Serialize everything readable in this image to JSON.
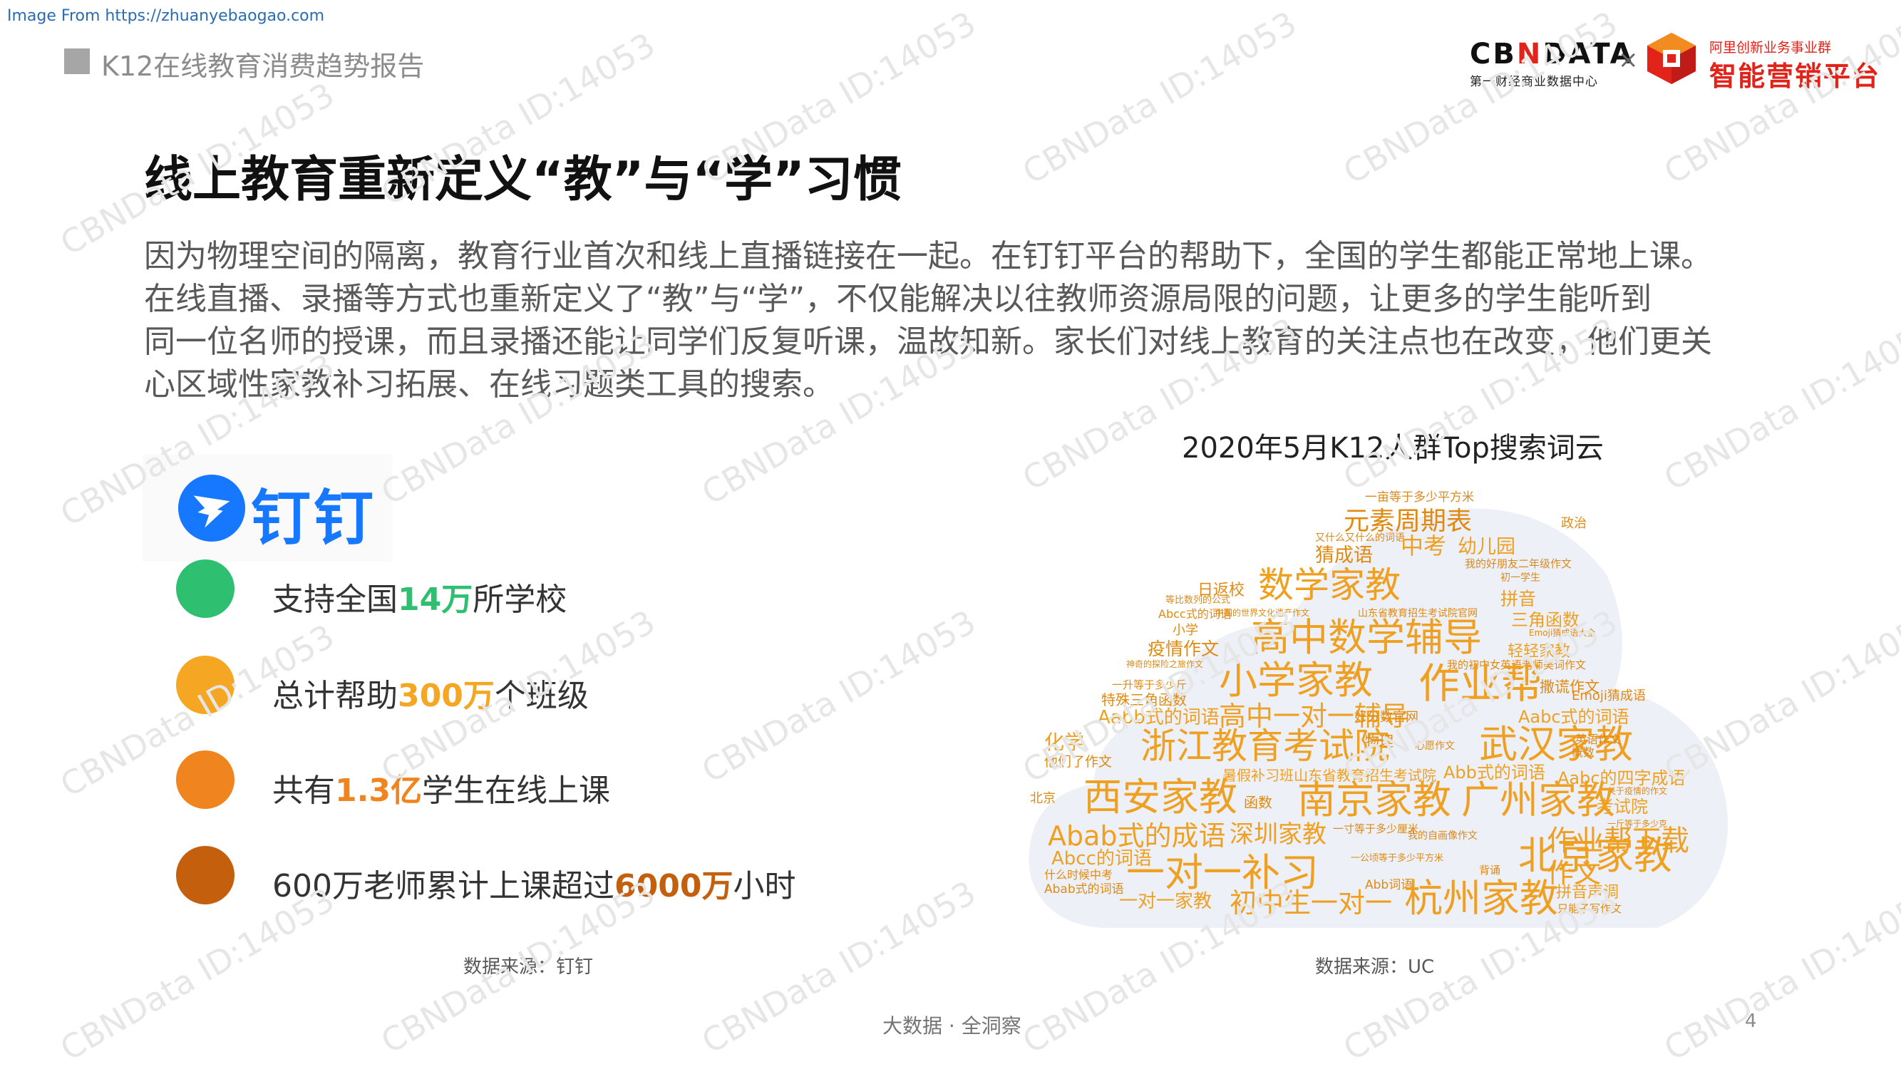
{
  "source_link": "Image From https://zhuanyebaogao.com",
  "report_title": "K12在线教育消费趋势报告",
  "heading": "线上教育重新定义“教”与“学”习惯",
  "intro_lines": [
    "因为物理空间的隔离，教育行业首次和线上直播链接在一起。在钉钉平台的帮助下，全国的学生都能正常地上课。",
    "在线直播、录播等方式也重新定义了“教”与“学”，不仅能解决以往教师资源局限的问题，让更多的学生能听到",
    "同一位名师的授课，而且录播还能让同学们反复听课，温故知新。家长们对线上教育的关注点也在改变，他们更关",
    "心区域性家教补习拓展、在线习题类工具的搜索。"
  ],
  "logos": {
    "cbn_pre": "CB",
    "cbn_n": "N",
    "cbn_post": "DATA",
    "cbn_sub": "第一财经商业数据中心",
    "times": "×",
    "ali_top": "阿里创新业务事业群",
    "ali_main": "智能营销平台"
  },
  "dingtalk": {
    "name": "钉钉",
    "icon": "dingtalk-logo-icon",
    "color": "#1677ff"
  },
  "stats": [
    {
      "pre": "支持全国",
      "hl": "14万",
      "post": "所学校",
      "color": "#2fbf71"
    },
    {
      "pre": "总计帮助",
      "hl": "300万",
      "post": "个班级",
      "color": "#f5a623"
    },
    {
      "pre": "共有",
      "hl": "1.3亿",
      "post": "学生在线上课",
      "color": "#f0841f"
    },
    {
      "pre": "600万老师累计上课超过",
      "hl": "6000万",
      "post": "小时",
      "color": "#c4600d"
    }
  ],
  "source_left": "数据来源：钉钉",
  "cloud": {
    "title": "2020年5月K12人群Top搜索词云",
    "source": "数据来源：UC",
    "words": [
      "一亩等于多少平方米",
      "元素周期表",
      "政治",
      "又什么又什么的词语",
      "猜成语",
      "中考",
      "幼儿园",
      "我的好朋友二年级作文",
      "初一学生",
      "日返校",
      "数学家教",
      "拼音",
      "等比数列的公式",
      "Abcc式的词语",
      "中国的世界文化遗产作文",
      "山东省教育招生考试院官网",
      "三角函数",
      "Emoji猜成语大全",
      "小学",
      "高中数学辅导",
      "疫情作文",
      "轻轻家教",
      "神奇的探险之旅作文",
      "我的初中女英语老师美词作文",
      "小学家教",
      "作业帮",
      "撒谎作文",
      "一升等于多少斤",
      "Emoji猜成语",
      "特殊三角函数",
      "Aabb式的词语",
      "高中一对一辅导",
      "好分数官网",
      "Aabc式的词语",
      "化学",
      "浙江教育考试院",
      "物理",
      "心愿作文",
      "武汉家教",
      "英语作文",
      "概数",
      "他们了作文",
      "暑假补习班山东省教育招生考试院",
      "Abb式的词语",
      "Aabc的四字成语",
      "关于疫情的作文",
      "北京",
      "西安家教",
      "函数",
      "南京家教",
      "广州家教",
      "考试院",
      "一斤等于多少克",
      "Abab式的成语",
      "深圳家教",
      "一寸等于多少厘米",
      "我的自画像作文",
      "作业帮下载",
      "Abcc的词语",
      "一公顷等于多少平方米",
      "北京家教",
      "什么时候中考",
      "一对一补习",
      "背诵",
      "Abab式的词语",
      "作文",
      "Abb词语",
      "拼音声调",
      "一对一家教",
      "初中生一对一",
      "杭州家教",
      "只能子写作文"
    ]
  },
  "footer": "大数据 · 全洞察",
  "page_number": "4",
  "watermark": "CBNData ID:14053"
}
